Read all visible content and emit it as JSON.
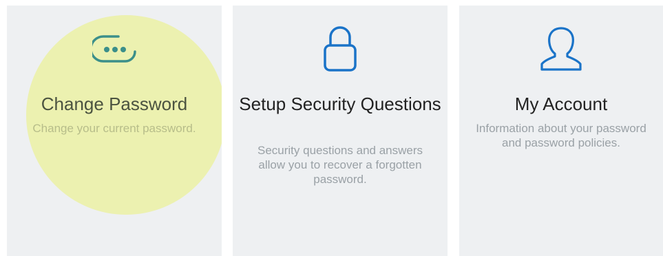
{
  "cards": [
    {
      "icon": "password-dots-icon",
      "title": "Change Password",
      "description": "Change your current password.",
      "highlighted": true,
      "highlight_color": "#ecf0a6",
      "icon_color": "#3b8f8a"
    },
    {
      "icon": "lock-icon",
      "title": "Setup Security Questions",
      "description": "Security questions and answers allow you to recover a forgotten password.",
      "icon_color": "#1a73c8"
    },
    {
      "icon": "user-icon",
      "title": "My Account",
      "description": "Information about your password and password policies.",
      "icon_color": "#1a73c8"
    }
  ],
  "colors": {
    "card_background": "#eef0f2",
    "title_text": "#222222",
    "description_text": "#9aa1a6"
  }
}
